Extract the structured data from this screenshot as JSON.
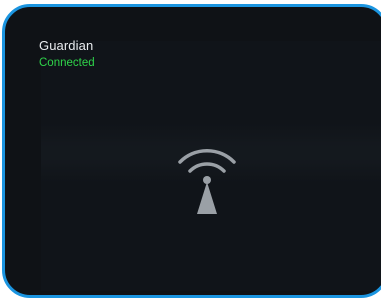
{
  "device": {
    "name": "Guardian",
    "status": "Connected",
    "status_color": "#2fd44a"
  },
  "center_icon": "broadcast-signal-icon",
  "accent_border_color": "#1b95e0"
}
